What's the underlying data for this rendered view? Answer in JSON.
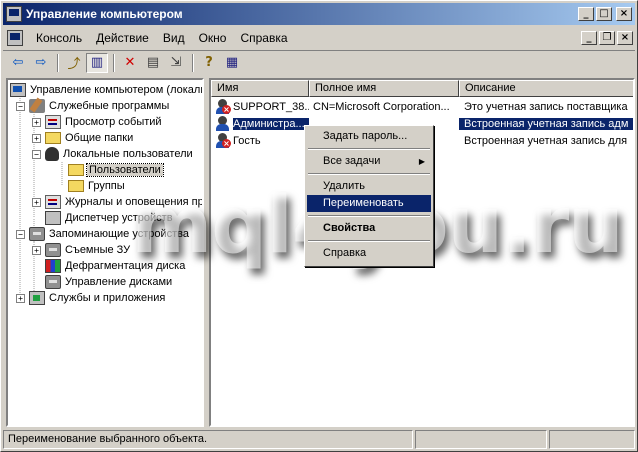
{
  "window": {
    "title": "Управление компьютером",
    "minimize_glyph": "_",
    "maximize_glyph": "□",
    "close_glyph": "×"
  },
  "menubar": {
    "items": [
      "Консоль",
      "Действие",
      "Вид",
      "Окно",
      "Справка"
    ],
    "child_minimize": "_",
    "child_restore": "❐",
    "child_close": "×"
  },
  "toolbar": {
    "buttons": [
      {
        "icon": "back-arrow-icon",
        "glyph": "⇦"
      },
      {
        "icon": "forward-arrow-icon",
        "glyph": "⇨"
      },
      {
        "icon": "up-folder-icon",
        "glyph": "⤴"
      },
      {
        "icon": "show-tree-icon",
        "glyph": "▥"
      },
      {
        "icon": "delete-icon",
        "glyph": "✕"
      },
      {
        "icon": "properties-icon",
        "glyph": "▤"
      },
      {
        "icon": "export-list-icon",
        "glyph": "⇲"
      },
      {
        "icon": "help-icon",
        "glyph": "?"
      },
      {
        "icon": "console-view-icon",
        "glyph": "▦"
      }
    ]
  },
  "tree": {
    "items": [
      {
        "label": "Управление компьютером (локаль",
        "icon": "computer-icon"
      },
      {
        "label": "Служебные программы",
        "icon": "tools-icon"
      },
      {
        "label": "Просмотр событий",
        "icon": "event-viewer-icon"
      },
      {
        "label": "Общие папки",
        "icon": "shared-folder-icon"
      },
      {
        "label": "Локальные пользователи",
        "icon": "local-users-icon"
      },
      {
        "label": "Пользователи",
        "icon": "folder-icon"
      },
      {
        "label": "Группы",
        "icon": "folder-icon"
      },
      {
        "label": "Журналы и оповещения пр",
        "icon": "logs-icon"
      },
      {
        "label": "Диспетчер устройств",
        "icon": "device-manager-icon"
      },
      {
        "label": "Запоминающие устройства",
        "icon": "storage-icon"
      },
      {
        "label": "Съемные ЗУ",
        "icon": "removable-storage-icon"
      },
      {
        "label": "Дефрагментация диска",
        "icon": "defrag-icon"
      },
      {
        "label": "Управление дисками",
        "icon": "disk-management-icon"
      },
      {
        "label": "Службы и приложения",
        "icon": "services-icon"
      }
    ]
  },
  "list": {
    "columns": [
      "Имя",
      "Полное имя",
      "Описание"
    ],
    "rows": [
      {
        "name": "SUPPORT_38...",
        "full_name": "CN=Microsoft Corporation...",
        "description": "Это учетная запись поставщика",
        "disabled": true
      },
      {
        "name": "Администра...",
        "full_name": "",
        "description": "Встроенная учетная запись адм",
        "disabled": false
      },
      {
        "name": "Гость",
        "full_name": "",
        "description": "Встроенная учетная запись для",
        "disabled": true
      }
    ]
  },
  "context_menu": {
    "items": [
      {
        "label": "Задать пароль..."
      },
      {
        "label": "Все задачи"
      },
      {
        "label": "Удалить"
      },
      {
        "label": "Переименовать"
      },
      {
        "label": "Свойства"
      },
      {
        "label": "Справка"
      }
    ],
    "submenu_arrow": "▶"
  },
  "watermark": "mql4you.ru",
  "statusbar": {
    "text": "Переименование выбранного объекта."
  }
}
